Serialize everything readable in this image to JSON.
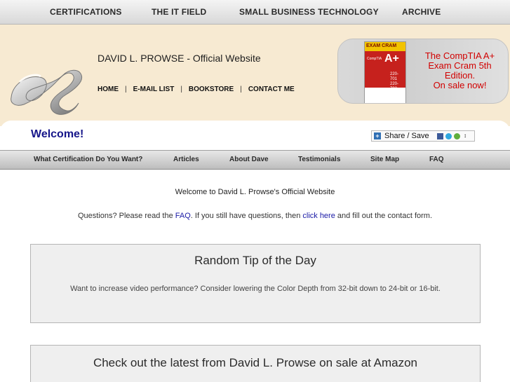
{
  "topnav": {
    "items": [
      "CERTIFICATIONS",
      "THE IT FIELD",
      "SMALL BUSINESS TECHNOLOGY",
      "ARCHIVE"
    ]
  },
  "header": {
    "site_title": "DAVID L. PROWSE - Official Website",
    "nav": [
      "HOME",
      "E-MAIL LIST",
      "BOOKSTORE",
      "CONTACT ME"
    ],
    "separator": "|"
  },
  "promo": {
    "book_series": "EXAM CRAM",
    "book_brand": "CompTIA",
    "book_title": "A+",
    "book_exams": [
      "220-701",
      "220-702"
    ],
    "text_lines": [
      "The CompTIA A+",
      "Exam Cram 5th",
      "Edition.",
      "On sale now!"
    ],
    "text_color": "#d10000"
  },
  "welcome": {
    "heading": "Welcome!",
    "share_label": "Share / Save"
  },
  "subnav": {
    "items": [
      "What Certification Do You Want?",
      "Articles",
      "About Dave",
      "Testimonials",
      "Site Map",
      "FAQ"
    ]
  },
  "content": {
    "intro_title": "Welcome to David L. Prowse's Official Website",
    "intro_prefix": "Questions? Please read the ",
    "faq_link": "FAQ",
    "intro_middle": ". If you still have questions, then ",
    "click_here_link": "click here",
    "intro_suffix": " and fill out the contact form."
  },
  "tip": {
    "heading": "Random Tip of the Day",
    "body": "Want to increase video performance? Consider lowering the Color Depth from 32-bit down to 24-bit or 16-bit."
  },
  "amazon": {
    "heading": "Check out the latest from David L. Prowse on sale at Amazon"
  },
  "colors": {
    "header_bg": "#f7ead2",
    "welcome_text": "#16168a",
    "link": "#1a1aa6"
  }
}
